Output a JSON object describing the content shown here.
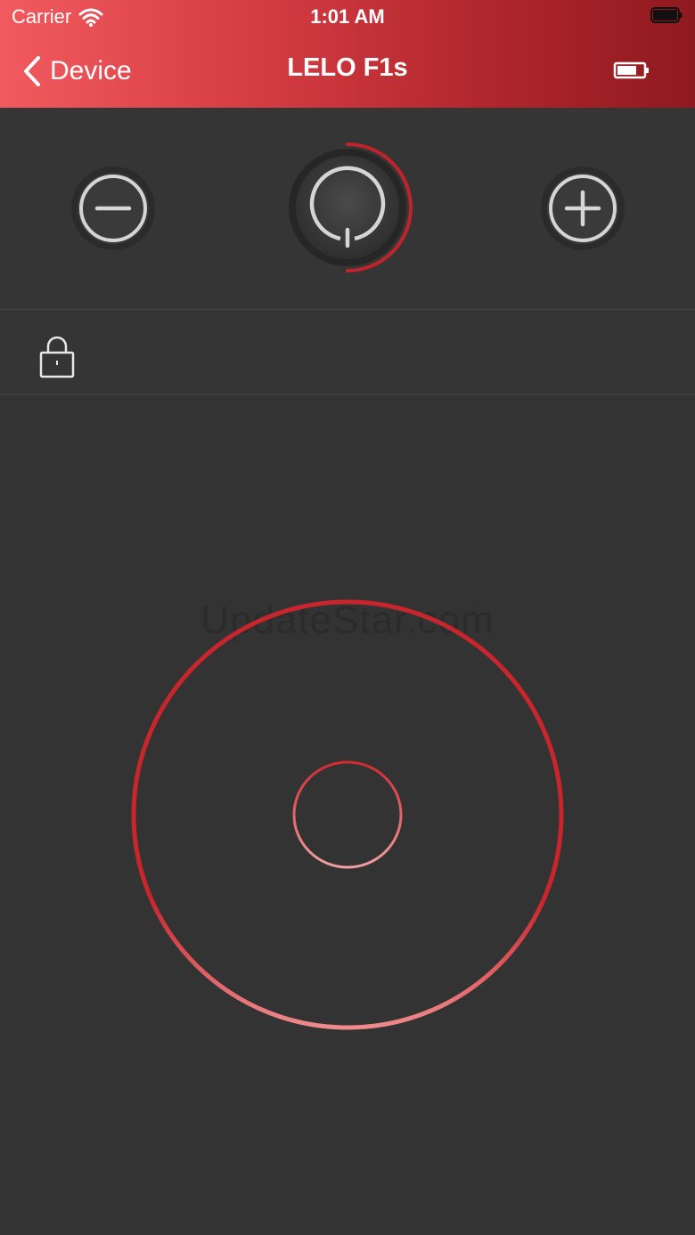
{
  "status_bar": {
    "carrier": "Carrier",
    "time": "1:01 AM"
  },
  "nav": {
    "back_label": "Device",
    "title": "LELO F1s"
  },
  "controls": {
    "decrease": "minus",
    "power": "power",
    "increase": "plus"
  },
  "watermark": "UpdateStar.com",
  "colors": {
    "accent_red": "#d7262d",
    "header_gradient_start": "#f15a5e",
    "header_gradient_end": "#8e1a1f",
    "background": "#333333"
  }
}
